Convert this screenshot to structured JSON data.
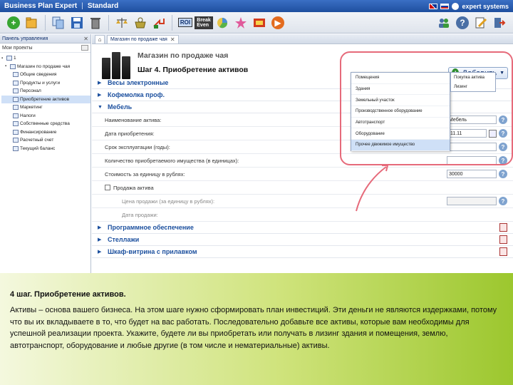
{
  "titlebar": {
    "app": "Business Plan Expert",
    "separator": "|",
    "edition": "Standard",
    "brand": "expert systems"
  },
  "toolbar": {
    "icons": [
      "add-icon",
      "folder-icon",
      "copy-icon",
      "save-icon",
      "delete-icon",
      "scales-icon",
      "bag-icon",
      "arrow-icon",
      "roi-icon",
      "break-even-icon",
      "pie-chart-icon",
      "stars-icon",
      "film-icon",
      "play-icon"
    ],
    "roi_label": "ROI",
    "break_label": "Break Even",
    "right_icons": [
      "users-icon",
      "help-icon",
      "edit-icon",
      "exit-icon"
    ]
  },
  "left_panel": {
    "title": "Панель управления",
    "projects_label": "Мои проекты",
    "tree": [
      {
        "label": "1",
        "level": 0
      },
      {
        "label": "Магазин по продаже чая",
        "level": 1
      },
      {
        "label": "Общие сведения",
        "level": 2
      },
      {
        "label": "Продукты и услуги",
        "level": 2
      },
      {
        "label": "Персонал",
        "level": 2
      },
      {
        "label": "Приобретение активов",
        "level": 2,
        "selected": true
      },
      {
        "label": "Маркетинг",
        "level": 2
      },
      {
        "label": "Налоги",
        "level": 2
      },
      {
        "label": "Собственные средства",
        "level": 2
      },
      {
        "label": "Финансирование",
        "level": 2
      },
      {
        "label": "Расчетный счет",
        "level": 2
      },
      {
        "label": "Текущий баланс",
        "level": 2
      }
    ]
  },
  "tabs": {
    "active": "Магазин по продаже чая"
  },
  "main": {
    "store_title": "Магазин по продаже чая",
    "step_title": "Шаг 4. Приобретение активов",
    "add_button": "Добавить",
    "sections": {
      "s1": "Весы электронные",
      "s2": "Кофемолка проф.",
      "s3": "Мебель",
      "s4": "Программное обеспечение",
      "s5": "Стеллажи",
      "s6": "Шкаф-витрина с прилавком"
    },
    "fields": {
      "name": "Наименование актива:",
      "name_value": "Мебель",
      "date": "Дата приобретения:",
      "date_value": ".11.11",
      "term": "Срок эксплуатации (годы):",
      "qty": "Количество приобретаемого имущества (в единицах):",
      "cost": "Стоимость за единицу в рублях:",
      "cost_value": "30000",
      "sale": "Продажа актива",
      "sale_price": "Цена продажи (за единицу в рублях):",
      "sale_date": "Дата продажи:"
    }
  },
  "menu": {
    "items": [
      "Помещения",
      "Здания",
      "Земельный участок",
      "Производственное оборудование",
      "Автотранспорт",
      "Оборудование",
      "Прочее движимое имущество"
    ],
    "submenu": [
      "Покупка актива",
      "Лизинг"
    ]
  },
  "bottom": {
    "title": "4 шаг. Приобретение активов.",
    "body": "Активы – основа вашего бизнеса. На этом шаге нужно сформировать план инвестиций. Эти деньги не являются издержками, потому что вы их вкладываете в то, что будет на вас работать. Последовательно добавьте все активы, которые вам необходимы для успешной реализации проекта. Укажите, будете ли вы приобретать или получать в лизинг здания и помещения, землю, автотранспорт, оборудование и любые другие (в том числе и нематериальные) активы."
  }
}
